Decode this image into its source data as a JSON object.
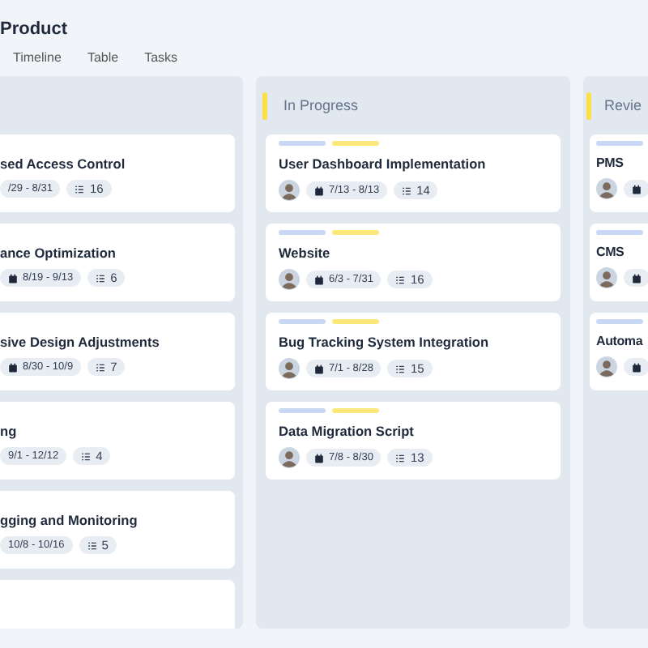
{
  "header": {
    "title": "Product"
  },
  "tabs": [
    {
      "label": "Timeline"
    },
    {
      "label": "Table"
    },
    {
      "label": "Tasks"
    }
  ],
  "columns": [
    {
      "kind": "cut-left",
      "cards": [
        {
          "kind": "text",
          "title": "sed Access Control",
          "dates": "/29 - 8/31",
          "count": "16"
        },
        {
          "kind": "icon",
          "title": "ance Optimization",
          "dates": "8/19 - 9/13",
          "count": "6"
        },
        {
          "kind": "icon",
          "title": "sive Design Adjustments",
          "dates": "8/30 - 10/9",
          "count": "7"
        },
        {
          "kind": "text",
          "title": "ng",
          "dates": "9/1 - 12/12",
          "count": "4"
        },
        {
          "kind": "text",
          "title": "gging and Monitoring",
          "dates": "10/8 - 10/16",
          "count": "5"
        },
        {
          "kind": "empty"
        }
      ]
    },
    {
      "kind": "full",
      "title": "In Progress",
      "cards": [
        {
          "kind": "avatar",
          "tags": [
            {
              "color": "#c7d7f4"
            },
            {
              "color": "#fbe77a"
            }
          ],
          "title": "User Dashboard Implementation",
          "dates": "7/13 - 8/13",
          "count": "14"
        },
        {
          "kind": "avatar",
          "tags": [
            {
              "color": "#c7d7f4"
            },
            {
              "color": "#fbe77a"
            }
          ],
          "title": "Website",
          "dates": "6/3 - 7/31",
          "count": "16"
        },
        {
          "kind": "avatar",
          "tags": [
            {
              "color": "#c7d7f4"
            },
            {
              "color": "#fbe77a"
            }
          ],
          "title": "Bug Tracking System Integration",
          "dates": "7/1 - 8/28",
          "count": "15"
        },
        {
          "kind": "avatar",
          "tags": [
            {
              "color": "#c7d7f4"
            },
            {
              "color": "#fbe77a"
            }
          ],
          "title": "Data Migration Script",
          "dates": "7/8 - 8/30",
          "count": "13"
        }
      ]
    },
    {
      "kind": "cut-right",
      "title": "Revie",
      "cards": [
        {
          "kind": "avatar",
          "tags": [
            {
              "color": "#c7d7f4"
            }
          ],
          "title": "PMS"
        },
        {
          "kind": "avatar",
          "tags": [
            {
              "color": "#c7d7f4"
            }
          ],
          "title": "CMS"
        },
        {
          "kind": "avatar",
          "tags": [
            {
              "color": "#c7d7f4"
            }
          ],
          "title": "Automa"
        }
      ]
    }
  ]
}
